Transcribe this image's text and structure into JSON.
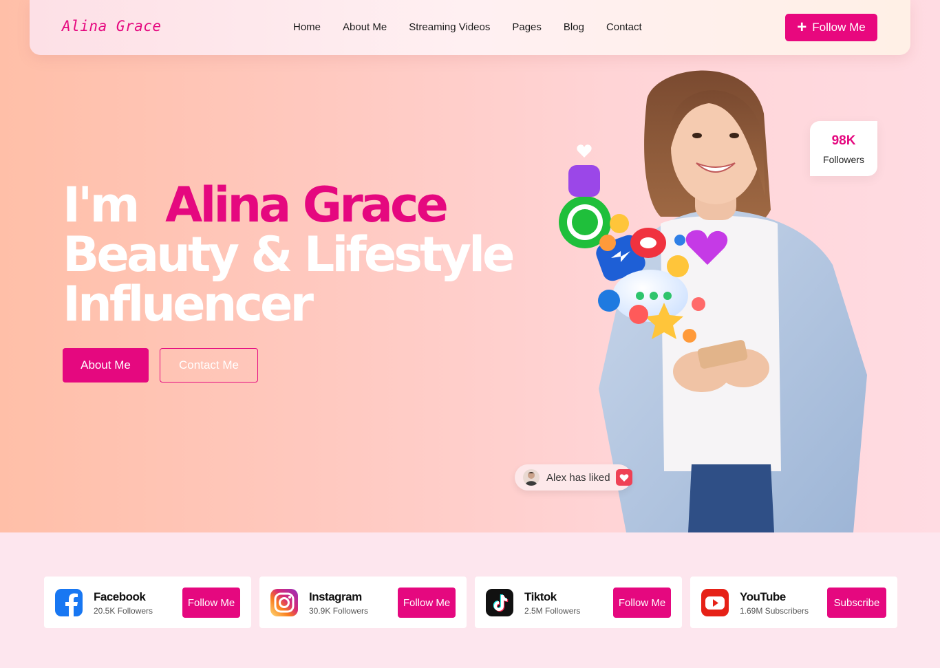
{
  "nav": {
    "logo": "Alina Grace",
    "links": [
      "Home",
      "About Me",
      "Streaming Videos",
      "Pages",
      "Blog",
      "Contact"
    ],
    "follow_label": "Follow Me"
  },
  "hero": {
    "prefix": "I'm",
    "name": "Alina Grace",
    "line2": "Beauty & Lifestyle",
    "line3": "Influencer",
    "about_btn": "About Me",
    "contact_btn": "Contact Me"
  },
  "followers_card": {
    "count": "98K",
    "label": "Followers"
  },
  "liked": {
    "text": "Alex has liked"
  },
  "social": [
    {
      "name": "Facebook",
      "count": "20.5K Followers",
      "button": "Follow Me",
      "icon": "facebook-icon"
    },
    {
      "name": "Instagram",
      "count": "30.9K Followers",
      "button": "Follow Me",
      "icon": "instagram-icon"
    },
    {
      "name": "Tiktok",
      "count": "2.5M Followers",
      "button": "Follow Me",
      "icon": "tiktok-icon"
    },
    {
      "name": "YouTube",
      "count": "1.69M Subscribers",
      "button": "Subscribe",
      "icon": "youtube-icon"
    }
  ],
  "colors": {
    "accent": "#e5087f",
    "heart": "#ef4155"
  }
}
